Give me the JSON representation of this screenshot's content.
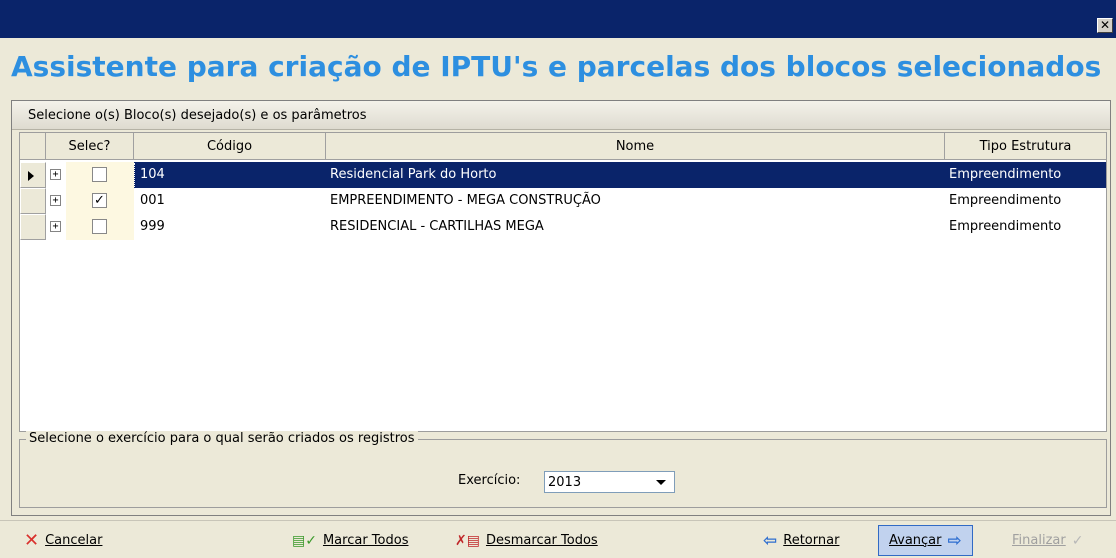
{
  "window": {
    "close_glyph": "✕"
  },
  "header": {
    "title": "Assistente para criação de IPTU's e parcelas dos blocos selecionados"
  },
  "panel": {
    "caption": "Selecione o(s) Bloco(s) desejado(s) e os parâmetros"
  },
  "grid": {
    "columns": {
      "selec": "Selec?",
      "codigo": "Código",
      "nome": "Nome",
      "tipo": "Tipo Estrutura"
    },
    "rows": [
      {
        "checked": false,
        "codigo": "104",
        "nome": "Residencial Park do Horto",
        "tipo": "Empreendimento",
        "selected": true
      },
      {
        "checked": true,
        "codigo": "001",
        "nome": "EMPREENDIMENTO - MEGA CONSTRUÇÃO",
        "tipo": "Empreendimento",
        "selected": false
      },
      {
        "checked": false,
        "codigo": "999",
        "nome": "RESIDENCIAL - CARTILHAS MEGA",
        "tipo": "Empreendimento",
        "selected": false
      }
    ],
    "expander_glyph": "+",
    "check_glyph": "✓"
  },
  "exercise": {
    "legend": "Selecione o exercício para o qual serão criados os registros",
    "label": "Exercício:",
    "value": "2013"
  },
  "buttons": {
    "cancelar": {
      "label": "Cancelar",
      "icon": "x-icon"
    },
    "marcar": {
      "label": "Marcar Todos",
      "icon": "check-document-icon"
    },
    "desmarcar": {
      "label": "Desmarcar Todos",
      "icon": "uncheck-document-icon"
    },
    "retornar": {
      "label": "Retornar",
      "icon": "arrow-left-icon"
    },
    "avancar": {
      "label": "Avançar",
      "icon": "arrow-right-icon"
    },
    "finalizar": {
      "label": "Finalizar",
      "icon": "checkmark-icon"
    }
  },
  "colors": {
    "titlebar": "#0a246a",
    "title_text": "#2d8fe0",
    "selection": "#0a246a",
    "checkbox_cell": "#fdf8e1"
  }
}
